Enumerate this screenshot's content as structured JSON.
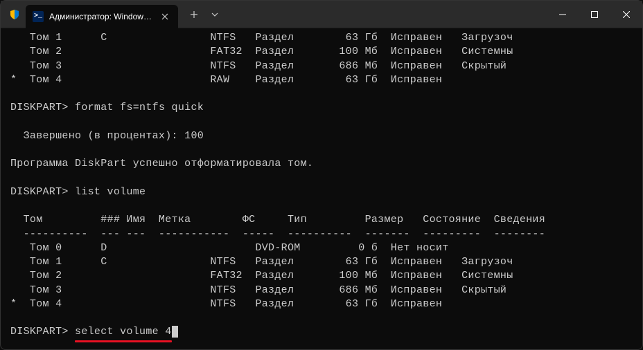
{
  "titlebar": {
    "tab_title": "Администратор: Windows Po",
    "ps_badge": ">_"
  },
  "vol_top": [
    {
      "mark": " ",
      "vol": "Том 1",
      "ltr": "C",
      "label": "",
      "fs": "NTFS",
      "type": "Раздел",
      "size": "63 Гб",
      "status": "Исправен",
      "info": "Загрузоч"
    },
    {
      "mark": " ",
      "vol": "Том 2",
      "ltr": "",
      "label": "",
      "fs": "FAT32",
      "type": "Раздел",
      "size": "100 Мб",
      "status": "Исправен",
      "info": "Системны"
    },
    {
      "mark": " ",
      "vol": "Том 3",
      "ltr": "",
      "label": "",
      "fs": "NTFS",
      "type": "Раздел",
      "size": "686 Мб",
      "status": "Исправен",
      "info": "Скрытый"
    },
    {
      "mark": "*",
      "vol": "Том 4",
      "ltr": "",
      "label": "",
      "fs": "RAW",
      "type": "Раздел",
      "size": "63 Гб",
      "status": "Исправен",
      "info": ""
    }
  ],
  "cmd1": {
    "prompt": "DISKPART>",
    "text": "format fs=ntfs quick"
  },
  "progress": "  Завершено (в процентах): 100",
  "msg1": "Программа DiskPart успешно отформатировала том.",
  "cmd2": {
    "prompt": "DISKPART>",
    "text": "list volume"
  },
  "hdr": {
    "vol": "Том",
    "num": "###",
    "ltr": "Имя",
    "label": "Метка",
    "fs": "ФС",
    "type": "Тип",
    "size": "Размер",
    "status": "Состояние",
    "info": "Сведения"
  },
  "sep": {
    "vol": "----------",
    "num": "---",
    "ltr": "---",
    "label": "-----------",
    "fs": "-----",
    "type": "----------",
    "size": "-------",
    "status": "---------",
    "info": "--------"
  },
  "vol_list": [
    {
      "mark": " ",
      "vol": "Том 0",
      "ltr": "D",
      "label": "",
      "fs": "",
      "type": "DVD-ROM",
      "size": "0 б",
      "status": "Нет носит",
      "info": ""
    },
    {
      "mark": " ",
      "vol": "Том 1",
      "ltr": "C",
      "label": "",
      "fs": "NTFS",
      "type": "Раздел",
      "size": "63 Гб",
      "status": "Исправен",
      "info": "Загрузоч"
    },
    {
      "mark": " ",
      "vol": "Том 2",
      "ltr": "",
      "label": "",
      "fs": "FAT32",
      "type": "Раздел",
      "size": "100 Мб",
      "status": "Исправен",
      "info": "Системны"
    },
    {
      "mark": " ",
      "vol": "Том 3",
      "ltr": "",
      "label": "",
      "fs": "NTFS",
      "type": "Раздел",
      "size": "686 Мб",
      "status": "Исправен",
      "info": "Скрытый"
    },
    {
      "mark": "*",
      "vol": "Том 4",
      "ltr": "",
      "label": "",
      "fs": "NTFS",
      "type": "Раздел",
      "size": "63 Гб",
      "status": "Исправен",
      "info": ""
    }
  ],
  "cmd3": {
    "prompt": "DISKPART>",
    "text": "select volume 4"
  }
}
